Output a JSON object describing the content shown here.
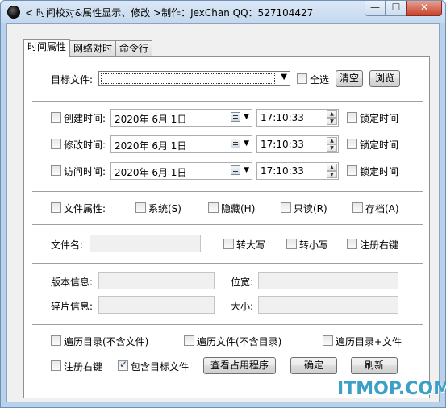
{
  "window": {
    "title": "< 时间校对&属性显示、修改 >制作：JexChan  QQ：527104427",
    "min_glyph": "—",
    "max_glyph": "☐",
    "close_glyph": "✕"
  },
  "tabs": [
    {
      "label": "时间属性",
      "active": true
    },
    {
      "label": "网络对时",
      "active": false
    },
    {
      "label": "命令行",
      "active": false
    }
  ],
  "target": {
    "label": "目标文件:",
    "value": "",
    "select_all": "全选",
    "clear_button": "清空",
    "browse_button": "浏览"
  },
  "times": {
    "create": {
      "label": "创建时间:",
      "date": "2020年  6月  1日",
      "time": "17:10:33",
      "lock": "锁定时间"
    },
    "modify": {
      "label": "修改时间:",
      "date": "2020年  6月  1日",
      "time": "17:10:33",
      "lock": "锁定时间"
    },
    "access": {
      "label": "访问时间:",
      "date": "2020年  6月  1日",
      "time": "17:10:33",
      "lock": "锁定时间"
    },
    "spin_up": "▲",
    "spin_down": "▼",
    "dropdown_arrow": "▼"
  },
  "attrs": {
    "label": "文件属性:",
    "system": "系统(S)",
    "hidden": "隐藏(H)",
    "readonly": "只读(R)",
    "archive": "存档(A)"
  },
  "filename": {
    "label": "文件名:",
    "value": "",
    "upper": "转大写",
    "lower": "转小写",
    "register_context": "注册右键"
  },
  "info": {
    "version_label": "版本信息:",
    "version_value": "",
    "bitness_label": "位宽:",
    "bitness_value": "",
    "fragment_label": "碎片信息:",
    "fragment_value": "",
    "size_label": "大小:",
    "size_value": ""
  },
  "bottom": {
    "traverse_dirs": "遍历目录(不含文件)",
    "traverse_files": "遍历文件(不含目录)",
    "traverse_both": "遍历目录+文件",
    "register_context": "注册右键",
    "include_target": "包含目标文件",
    "include_target_checked": true,
    "view_process_button": "查看占用程序",
    "ok_button": "确定",
    "refresh_button": "刷新"
  },
  "watermark": "ITMOP.COM",
  "dropdown_arrow": "▼"
}
